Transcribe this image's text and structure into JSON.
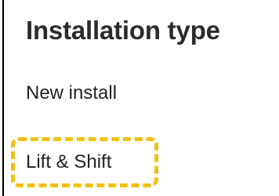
{
  "section": {
    "title": "Installation type"
  },
  "options": [
    {
      "label": "New install"
    },
    {
      "label": "Lift & Shift"
    }
  ],
  "colors": {
    "highlight": "#f2c011",
    "text": "#222222",
    "background": "#ffffff"
  }
}
